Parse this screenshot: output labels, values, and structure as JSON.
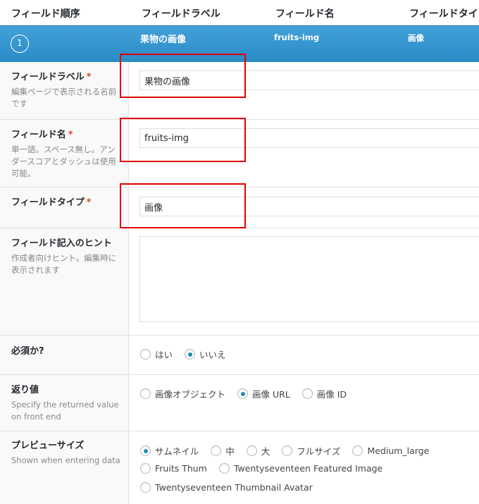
{
  "columns": {
    "order": "フィールド順序",
    "label": "フィールドラベル",
    "name": "フィールド名",
    "type": "フィールドタイプ"
  },
  "field_bar": {
    "order": "1",
    "label": "果物の画像",
    "name": "fruits-img",
    "type": "画像"
  },
  "rows": {
    "label": {
      "title": "フィールドラベル",
      "required": "*",
      "desc": "編集ページで表示される名前です",
      "value": "果物の画像"
    },
    "name": {
      "title": "フィールド名",
      "required": "*",
      "desc": "単一語。スペース無し。アンダースコアとダッシュは使用可能。",
      "value": "fruits-img"
    },
    "type": {
      "title": "フィールドタイプ",
      "required": "*",
      "value": "画像"
    },
    "hint": {
      "title": "フィールド記入のヒント",
      "desc": "作成者向けヒント。編集時に表示されます",
      "value": ""
    },
    "required_q": {
      "title": "必須か?",
      "options": [
        "はい",
        "いいえ"
      ],
      "selected": "いいえ"
    },
    "return": {
      "title": "返り値",
      "desc": "Specify the returned value on front end",
      "options": [
        "画像オブジェクト",
        "画像 URL",
        "画像 ID"
      ],
      "selected": "画像 URL"
    },
    "preview": {
      "title": "プレビューサイズ",
      "desc": "Shown when entering data",
      "options": [
        "サムネイル",
        "中",
        "大",
        "フルサイズ",
        "Medium_large",
        "Fruits Thum",
        "Twentyseventeen Featured Image",
        "Twentyseventeen Thumbnail Avatar"
      ],
      "selected": "サムネイル"
    }
  },
  "colors": {
    "bar": "#2a8bc7",
    "highlight": "#e30000",
    "radio_checked": "#1e8cbe",
    "required": "#d54e21"
  }
}
